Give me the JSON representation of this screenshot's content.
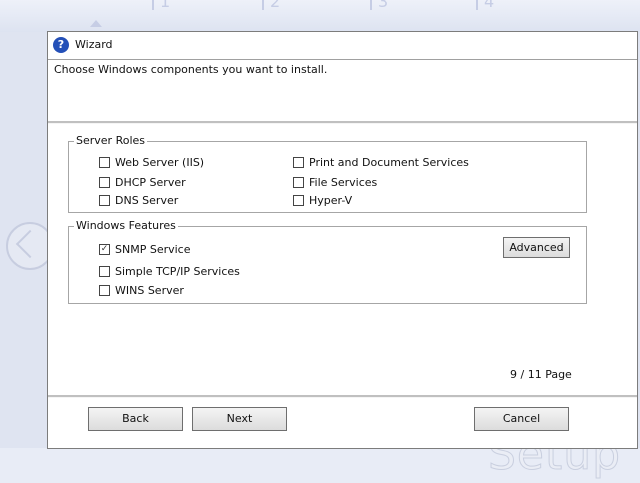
{
  "background": {
    "step_numbers": [
      "1",
      "2",
      "3",
      "4"
    ],
    "watermark": "Setup"
  },
  "window": {
    "title": "Wizard",
    "icon": "question-icon"
  },
  "header": {
    "instruction": "Choose Windows components you want to install."
  },
  "server_roles": {
    "legend": "Server Roles",
    "items": [
      {
        "label": "Web Server (IIS)",
        "checked": false
      },
      {
        "label": "DHCP Server",
        "checked": false
      },
      {
        "label": "DNS Server",
        "checked": false
      },
      {
        "label": "Print and Document Services",
        "checked": false
      },
      {
        "label": "File Services",
        "checked": false
      },
      {
        "label": "Hyper-V",
        "checked": false
      }
    ]
  },
  "windows_features": {
    "legend": "Windows Features",
    "items": [
      {
        "label": "SNMP Service",
        "checked": true
      },
      {
        "label": "Simple TCP/IP Services",
        "checked": false
      },
      {
        "label": "WINS Server",
        "checked": false
      }
    ],
    "advanced_label": "Advanced"
  },
  "pagination": {
    "text": "9 / 11 Page"
  },
  "footer": {
    "back_label": "Back",
    "next_label": "Next",
    "cancel_label": "Cancel"
  },
  "colors": {
    "background": "#dfe4f1",
    "window": "#ffffff",
    "icon_blue": "#2450b8"
  }
}
